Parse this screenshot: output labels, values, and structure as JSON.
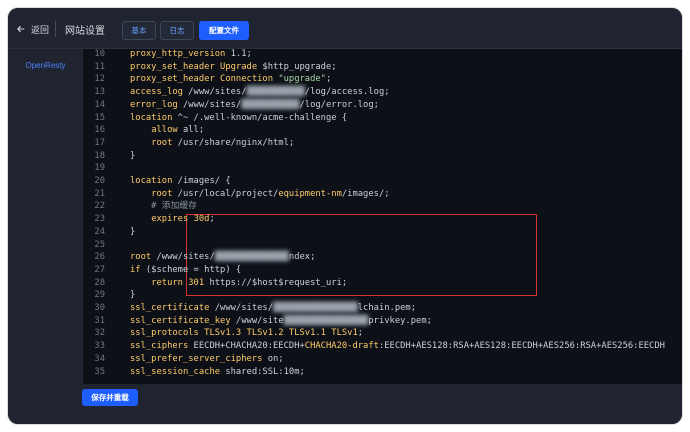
{
  "topbar": {
    "back_label": "返回",
    "title": "网站设置",
    "tabs": [
      {
        "label": "基本",
        "active": false
      },
      {
        "label": "日志",
        "active": false
      },
      {
        "label": "配置文件",
        "active": true
      }
    ]
  },
  "sidebar": {
    "items": [
      {
        "label": "OpenResty",
        "active": true
      }
    ]
  },
  "editor": {
    "lines": [
      {
        "num": "10",
        "code": "proxy_http_version 1.1;"
      },
      {
        "num": "11",
        "code": "proxy_set_header Upgrade $http_upgrade;"
      },
      {
        "num": "12",
        "code": "proxy_set_header Connection \"upgrade\";"
      },
      {
        "num": "13",
        "code": "access_log /www/sites/███████████/log/access.log;"
      },
      {
        "num": "14",
        "code": "error_log /www/sites/███████████/log/error.log;"
      },
      {
        "num": "15",
        "code": "location ^~ /.well-known/acme-challenge {"
      },
      {
        "num": "16",
        "code": "    allow all;"
      },
      {
        "num": "17",
        "code": "    root /usr/share/nginx/html;"
      },
      {
        "num": "18",
        "code": "}"
      },
      {
        "num": "19",
        "code": ""
      },
      {
        "num": "20",
        "code": "location /images/ {"
      },
      {
        "num": "21",
        "code": "    root /usr/local/project/equipment-nm/images/;"
      },
      {
        "num": "22",
        "code": "    # 添加缓存"
      },
      {
        "num": "23",
        "code": "    expires 30d;"
      },
      {
        "num": "24",
        "code": "}"
      },
      {
        "num": "25",
        "code": ""
      },
      {
        "num": "26",
        "code": "root /www/sites/██████████████ndex;"
      },
      {
        "num": "27",
        "code": "if ($scheme = http) {"
      },
      {
        "num": "28",
        "code": "    return 301 https://$host$request_uri;"
      },
      {
        "num": "29",
        "code": "}"
      },
      {
        "num": "30",
        "code": "ssl_certificate /www/sites/████████████████lchain.pem;"
      },
      {
        "num": "31",
        "code": "ssl_certificate_key /www/site████████████████privkey.pem;"
      },
      {
        "num": "32",
        "code": "ssl_protocols TLSv1.3 TLSv1.2 TLSv1.1 TLSv1;"
      },
      {
        "num": "33",
        "code": "ssl_ciphers EECDH+CHACHA20:EECDH+CHACHA20-draft:EECDH+AES128:RSA+AES128:EECDH+AES256:RSA+AES256:EECDH"
      },
      {
        "num": "34",
        "code": "ssl_prefer_server_ciphers on;"
      },
      {
        "num": "35",
        "code": "ssl_session_cache shared:SSL:10m;"
      }
    ]
  },
  "footer": {
    "save_label": "保存并重载"
  },
  "colors": {
    "accent": "#1e5eff",
    "highlight_border": "#d93030",
    "editor_bg": "#0d1117",
    "chrome_bg": "#1f2430"
  }
}
